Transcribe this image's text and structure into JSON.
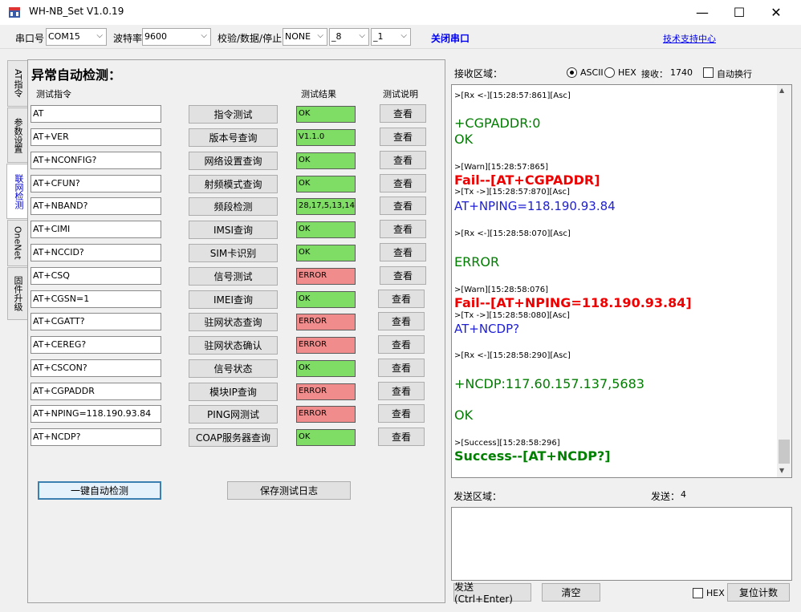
{
  "window": {
    "title": "WH-NB_Set V1.0.19",
    "minimize": "—",
    "maximize": "☐",
    "close": "✕"
  },
  "toolbar": {
    "port_label": "串口号",
    "port_value": "COM15",
    "baud_label": "波特率",
    "baud_value": "9600",
    "params_label": "校验/数据/停止",
    "parity_value": "NONE",
    "data_bits_value": "_8",
    "stop_bits_value": "_1",
    "close_port": "关闭串口",
    "tech_support": "技术支持中心"
  },
  "tabs": [
    {
      "label": "AT指令"
    },
    {
      "label": "参数设置"
    },
    {
      "label": "联网检测"
    },
    {
      "label": "OneNet"
    },
    {
      "label": "固件升级"
    }
  ],
  "panel": {
    "heading": "异常自动检测：",
    "col_cmd": "测试指令",
    "col_result": "测试结果",
    "col_desc": "测试说明",
    "view_label": "查看",
    "auto_button": "一键自动检测",
    "save_button": "保存测试日志"
  },
  "tests": [
    {
      "cmd": "AT",
      "button": "指令测试",
      "result": "OK",
      "status": "ok"
    },
    {
      "cmd": "AT+VER",
      "button": "版本号查询",
      "result": "V1.1.0",
      "status": "ok"
    },
    {
      "cmd": "AT+NCONFIG?",
      "button": "网络设置查询",
      "result": "OK",
      "status": "ok"
    },
    {
      "cmd": "AT+CFUN?",
      "button": "射频模式查询",
      "result": "OK",
      "status": "ok"
    },
    {
      "cmd": "AT+NBAND?",
      "button": "频段检测",
      "result": "28,17,5,13,14",
      "status": "ok"
    },
    {
      "cmd": "AT+CIMI",
      "button": "IMSI查询",
      "result": "OK",
      "status": "ok"
    },
    {
      "cmd": "AT+NCCID?",
      "button": "SIM卡识别",
      "result": "OK",
      "status": "ok"
    },
    {
      "cmd": "AT+CSQ",
      "button": "信号测试",
      "result": "ERROR",
      "status": "error"
    },
    {
      "cmd": "AT+CGSN=1",
      "button": "IMEI查询",
      "result": "OK",
      "status": "ok"
    },
    {
      "cmd": "AT+CGATT?",
      "button": "驻网状态查询",
      "result": "ERROR",
      "status": "error"
    },
    {
      "cmd": "AT+CEREG?",
      "button": "驻网状态确认",
      "result": "ERROR",
      "status": "error"
    },
    {
      "cmd": "AT+CSCON?",
      "button": "信号状态",
      "result": "OK",
      "status": "ok"
    },
    {
      "cmd": "AT+CGPADDR",
      "button": "模块IP查询",
      "result": "ERROR",
      "status": "error"
    },
    {
      "cmd": "AT+NPING=118.190.93.84",
      "button": "PING网测试",
      "result": "ERROR",
      "status": "error"
    },
    {
      "cmd": "AT+NCDP?",
      "button": "COAP服务器查询",
      "result": "OK",
      "status": "ok"
    }
  ],
  "receive": {
    "label": "接收区域：",
    "ascii": "ASCII",
    "hex": "HEX",
    "count_label": "接收：",
    "count": "1740",
    "autowrap": "自动换行"
  },
  "log": [
    {
      "type": "meta",
      "text": ">[Rx <-][15:28:57:861][Asc]"
    },
    {
      "type": "resp",
      "text": "+CGPADDR:0"
    },
    {
      "type": "resp",
      "text": "OK"
    },
    {
      "type": "meta",
      "text": ">[Warn][15:28:57:865]"
    },
    {
      "type": "fail",
      "prefix": "Fail",
      "text": "--[AT+CGPADDR]"
    },
    {
      "type": "meta",
      "text": ">[Tx ->][15:28:57:870][Asc]"
    },
    {
      "type": "tx",
      "text": "AT+NPING=118.190.93.84"
    },
    {
      "type": "meta",
      "text": ">[Rx <-][15:28:58:070][Asc]"
    },
    {
      "type": "resp",
      "text": "ERROR"
    },
    {
      "type": "meta",
      "text": ">[Warn][15:28:58:076]"
    },
    {
      "type": "fail",
      "prefix": "Fail",
      "text": "--[AT+NPING=118.190.93.84]"
    },
    {
      "type": "meta",
      "text": ">[Tx ->][15:28:58:080][Asc]"
    },
    {
      "type": "tx",
      "text": "AT+NCDP?"
    },
    {
      "type": "meta",
      "text": ">[Rx <-][15:28:58:290][Asc]"
    },
    {
      "type": "resp",
      "text": "+NCDP:117.60.157.137,5683"
    },
    {
      "type": "resp",
      "text": "OK"
    },
    {
      "type": "meta",
      "text": ">[Success][15:28:58:296]"
    },
    {
      "type": "succ",
      "prefix": "Success",
      "text": "--[AT+NCDP?]"
    }
  ],
  "send": {
    "label": "发送区域：",
    "count_label": "发送：",
    "count": "4",
    "send_button": "发送(Ctrl+Enter)",
    "clear_button": "清空",
    "hex": "HEX",
    "reset_button": "复位计数"
  },
  "colors": {
    "ok": "#7fdc64",
    "error": "#f08c8c"
  }
}
